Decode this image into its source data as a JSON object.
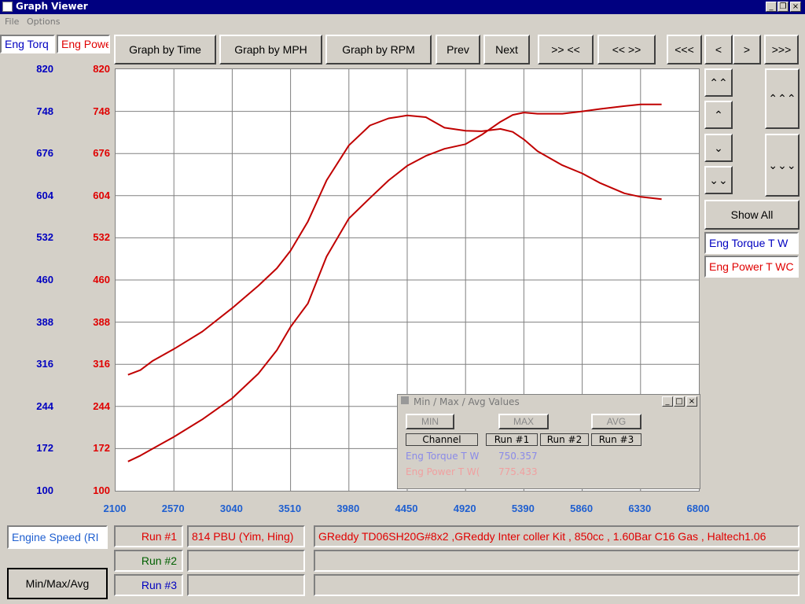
{
  "window": {
    "title": "Graph Viewer",
    "minimize": "_",
    "restore": "❐",
    "close": "×"
  },
  "menu": [
    "File",
    "Options"
  ],
  "toolbar": {
    "time": "Graph by Time",
    "mph": "Graph by MPH",
    "rpm": "Graph by RPM",
    "prev": "Prev",
    "next": "Next",
    "zoom_in": ">> <<",
    "zoom_out": "<< >>",
    "first": "<<<",
    "left": "<",
    "right": ">",
    "last": ">>>"
  },
  "axis_labels": {
    "torque": "Eng Torq",
    "power": "Eng Powe",
    "x": "Engine Speed (RI"
  },
  "colors": {
    "torque": "#0000c0",
    "power": "#e00000",
    "curve": "#c00000"
  },
  "side": {
    "show_all": "Show All",
    "channels": [
      "Eng Torque T W",
      "Eng Power T WC"
    ],
    "up2": "⌃⌃",
    "up": "⌃",
    "down": "⌄",
    "down2": "⌄⌄",
    "up3": "⌃⌃⌃",
    "down3": "⌄⌄⌄"
  },
  "chart_data": {
    "type": "line",
    "xlabel": "Engine Speed (RI",
    "x_ticks": [
      "2100",
      "2570",
      "3040",
      "3510",
      "3980",
      "4450",
      "4920",
      "5390",
      "5860",
      "6330",
      "6800"
    ],
    "y_ticks": [
      "820",
      "748",
      "676",
      "604",
      "532",
      "460",
      "388",
      "316",
      "244",
      "172",
      "100"
    ],
    "xlim": [
      2100,
      6800
    ],
    "ylim": [
      100,
      820
    ],
    "grid": true,
    "series": [
      {
        "name": "Eng Torque T W",
        "x": [
          2200,
          2300,
          2400,
          2570,
          2800,
          3040,
          3250,
          3400,
          3510,
          3650,
          3800,
          3980,
          4150,
          4300,
          4450,
          4600,
          4750,
          4920,
          5050,
          5200,
          5300,
          5390,
          5500,
          5700,
          5860,
          6000,
          6200,
          6330,
          6500
        ],
        "y": [
          298,
          306,
          322,
          342,
          372,
          412,
          450,
          480,
          510,
          560,
          630,
          690,
          724,
          736,
          741,
          738,
          720,
          715,
          714,
          718,
          713,
          700,
          680,
          656,
          642,
          626,
          608,
          602,
          598
        ]
      },
      {
        "name": "Eng Power T WC",
        "x": [
          2200,
          2300,
          2400,
          2570,
          2800,
          3040,
          3250,
          3400,
          3510,
          3650,
          3800,
          3980,
          4150,
          4300,
          4450,
          4600,
          4750,
          4920,
          5050,
          5200,
          5300,
          5390,
          5500,
          5700,
          5860,
          6000,
          6200,
          6330,
          6500
        ],
        "y": [
          150,
          160,
          172,
          192,
          222,
          258,
          300,
          340,
          380,
          420,
          500,
          565,
          600,
          630,
          655,
          672,
          684,
          692,
          708,
          730,
          742,
          746,
          744,
          744,
          748,
          752,
          757,
          760,
          760
        ]
      }
    ]
  },
  "popup": {
    "title": "Min / Max / Avg Values",
    "min": "MIN",
    "max": "MAX",
    "avg": "AVG",
    "headers": [
      "Channel",
      "Run #1",
      "Run #2",
      "Run #3"
    ],
    "rows": [
      {
        "channel": "Eng Torque T W",
        "run1": "750.357"
      },
      {
        "channel": "Eng Power T W(",
        "run1": "775.433"
      }
    ]
  },
  "bottom": {
    "runs": [
      {
        "label": "Run #1",
        "color": "#e00000",
        "car": "814 PBU (Yim, Hing)",
        "desc": "GReddy TD06SH20G#8x2 ,GReddy Inter coller Kit , 850cc , 1.60Bar  C16 Gas , Haltech1.06"
      },
      {
        "label": "Run #2",
        "color": "#006000",
        "car": "",
        "desc": ""
      },
      {
        "label": "Run #3",
        "color": "#0000c0",
        "car": "",
        "desc": ""
      }
    ],
    "minmax": "Min/Max/Avg"
  }
}
